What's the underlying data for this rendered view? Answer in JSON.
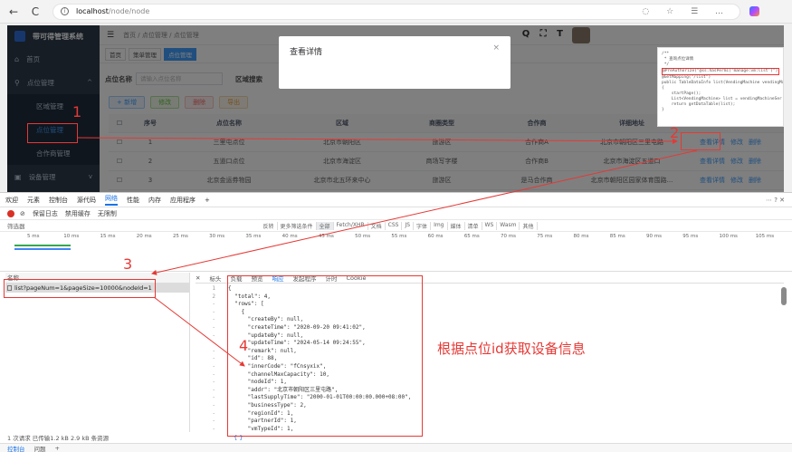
{
  "browser": {
    "back": "←",
    "reload": "C",
    "url_host": "localhost",
    "url_path": "/node/node",
    "right_icons": "◌ ☆ ☰ …"
  },
  "app": {
    "title": "带可得管理系统",
    "breadcrumb": [
      "首页",
      "点位管理",
      "点位管理"
    ],
    "tags": [
      "首页",
      "策单管理",
      "点位管理"
    ],
    "sidebar": [
      {
        "label": "首页"
      },
      {
        "label": "点位管理"
      },
      {
        "label": "区域管理"
      },
      {
        "label": "点位管理"
      },
      {
        "label": "合作商管理"
      },
      {
        "label": "设备管理"
      }
    ],
    "filters": {
      "point_label": "点位名称",
      "point_placeholder": "请输入点位名称",
      "region_label": "区域搜索"
    },
    "actions": [
      "+ 新增",
      "修改",
      "删除",
      "导出"
    ],
    "table": {
      "headers": [
        "序号",
        "点位名称",
        "区域",
        "商圈类型",
        "合作商",
        "详细地址"
      ],
      "rows": [
        {
          "no": "1",
          "name": "三里屯点位",
          "region": "北京市朝阳区",
          "type": "旅游区",
          "partner": "合作商A",
          "address": "北京市朝阳区三里屯路"
        },
        {
          "no": "2",
          "name": "五道口点位",
          "region": "北京市海淀区",
          "type": "商场写字楼",
          "partner": "合作商B",
          "address": "北京市海淀区五道口"
        },
        {
          "no": "3",
          "name": "北京金运券物园",
          "region": "北京市北五环来中心",
          "type": "旅游区",
          "partner": "是马合作商",
          "address": "北京市朝阳区园家体育围路..."
        }
      ],
      "ops": [
        "查看详情",
        "修改",
        "删除"
      ]
    }
  },
  "modal": {
    "title": "查看详情",
    "close": "×"
  },
  "code_snippet": {
    "lines": [
      "/**",
      " * 查询点位详情",
      " */",
      "@PreAuthorize(\"@ss.hasPermi('manage:vm:list')\")",
      "@GetMapping(\"/list\")",
      "public TableDataInfo list(VendingMachine vendingMac",
      "{",
      "    startPage();",
      "    List<VendingMachine> list = vendingMachineSer",
      "    return getDataTable(list);",
      "}"
    ]
  },
  "devtools": {
    "tabs": [
      "欢迎",
      "元素",
      "控制台",
      "源代码",
      "网络",
      "性能",
      "内存",
      "应用程序",
      "+"
    ],
    "toolbar": [
      "保留日志",
      "禁用缓存",
      "无限制"
    ],
    "filter_placeholder": "筛选器",
    "filter_options": [
      "反转",
      "更多筛选条件"
    ],
    "types": [
      "全部",
      "Fetch/XHR",
      "文档",
      "CSS",
      "JS",
      "字体",
      "Img",
      "媒体",
      "清单",
      "WS",
      "Wasm",
      "其他"
    ],
    "ticks": [
      "5 ms",
      "10 ms",
      "15 ms",
      "20 ms",
      "25 ms",
      "30 ms",
      "35 ms",
      "40 ms",
      "45 ms",
      "50 ms",
      "55 ms",
      "60 ms",
      "65 ms",
      "70 ms",
      "75 ms",
      "80 ms",
      "85 ms",
      "90 ms",
      "95 ms",
      "100 ms",
      "105 ms"
    ],
    "name_header": "名称",
    "request": "list?pageNum=1&pageSize=10000&nodeId=1",
    "detail_tabs": [
      "标头",
      "负载",
      "预览",
      "响应",
      "发起程序",
      "计时",
      "Cookie"
    ],
    "status": "1 次请求  已传输1.2 kB  2.9 kB 条资源",
    "braces": "{ }",
    "console_tabs": [
      "控制台",
      "问题",
      "+"
    ]
  },
  "response_json": [
    {
      "t": "{",
      "cls": ""
    },
    {
      "t": "  \"total\": 4,",
      "cls": ""
    },
    {
      "t": "  \"rows\": [",
      "cls": ""
    },
    {
      "t": "    {",
      "cls": ""
    },
    {
      "t": "      \"createBy\": null,",
      "cls": ""
    },
    {
      "t": "      \"createTime\": \"2020-09-20 09:41:02\",",
      "cls": ""
    },
    {
      "t": "      \"updateBy\": null,",
      "cls": ""
    },
    {
      "t": "      \"updateTime\": \"2024-05-14 09:24:55\",",
      "cls": ""
    },
    {
      "t": "      \"remark\": null,",
      "cls": ""
    },
    {
      "t": "      \"id\": 88,",
      "cls": ""
    },
    {
      "t": "      \"innerCode\": \"fCnsyxix\",",
      "cls": ""
    },
    {
      "t": "      \"channelMaxCapacity\": 10,",
      "cls": ""
    },
    {
      "t": "      \"nodeId\": 1,",
      "cls": ""
    },
    {
      "t": "      \"addr\": \"北京市朝阳区三里屯路\",",
      "cls": ""
    },
    {
      "t": "      \"lastSupplyTime\": \"2000-01-01T00:00:00.000+08:00\",",
      "cls": ""
    },
    {
      "t": "      \"businessType\": 2,",
      "cls": ""
    },
    {
      "t": "      \"regionId\": 1,",
      "cls": ""
    },
    {
      "t": "      \"partnerId\": 1,",
      "cls": ""
    },
    {
      "t": "      \"vmTypeId\": 1,",
      "cls": ""
    }
  ],
  "gutter": [
    "1",
    "2",
    "-",
    "-",
    "-",
    "-",
    "-",
    "-",
    "-",
    "-",
    "-",
    "-",
    "-",
    "-",
    "-",
    "-",
    "-",
    "-",
    "-"
  ],
  "annotations": {
    "n1": "1",
    "n2": "2",
    "n3": "3",
    "n4": "4",
    "caption": "根据点位id获取设备信息",
    "color": "#e53935"
  }
}
